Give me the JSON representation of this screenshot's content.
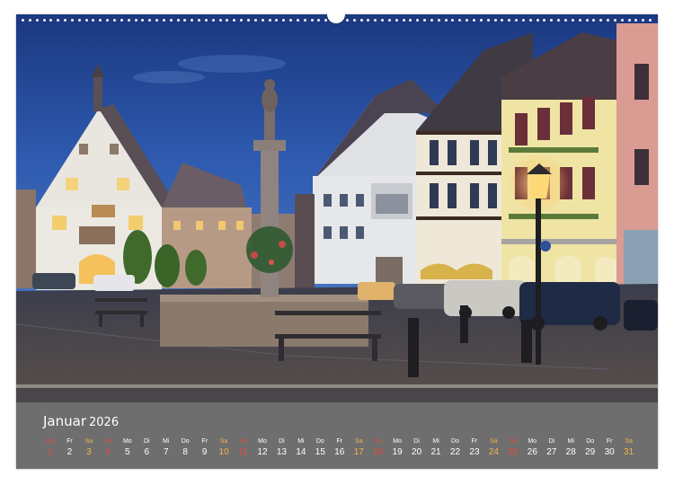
{
  "calendar": {
    "month": "Januar",
    "year": "2026",
    "colors": {
      "background": "#6e6e6e",
      "weekday": "#ffffff",
      "saturday": "#f5b14a",
      "sunday": "#e34b3c"
    },
    "days": [
      {
        "wd": "Do",
        "d": "1",
        "type": "holiday"
      },
      {
        "wd": "Fr",
        "d": "2",
        "type": "weekday"
      },
      {
        "wd": "Sa",
        "d": "3",
        "type": "sat"
      },
      {
        "wd": "So",
        "d": "4",
        "type": "sun"
      },
      {
        "wd": "Mo",
        "d": "5",
        "type": "weekday"
      },
      {
        "wd": "Di",
        "d": "6",
        "type": "weekday"
      },
      {
        "wd": "Mi",
        "d": "7",
        "type": "weekday"
      },
      {
        "wd": "Do",
        "d": "8",
        "type": "weekday"
      },
      {
        "wd": "Fr",
        "d": "9",
        "type": "weekday"
      },
      {
        "wd": "Sa",
        "d": "10",
        "type": "sat"
      },
      {
        "wd": "So",
        "d": "11",
        "type": "sun"
      },
      {
        "wd": "Mo",
        "d": "12",
        "type": "weekday"
      },
      {
        "wd": "Di",
        "d": "13",
        "type": "weekday"
      },
      {
        "wd": "Mi",
        "d": "14",
        "type": "weekday"
      },
      {
        "wd": "Do",
        "d": "15",
        "type": "weekday"
      },
      {
        "wd": "Fr",
        "d": "16",
        "type": "weekday"
      },
      {
        "wd": "Sa",
        "d": "17",
        "type": "sat"
      },
      {
        "wd": "So",
        "d": "18",
        "type": "sun"
      },
      {
        "wd": "Mo",
        "d": "19",
        "type": "weekday"
      },
      {
        "wd": "Di",
        "d": "20",
        "type": "weekday"
      },
      {
        "wd": "Mi",
        "d": "21",
        "type": "weekday"
      },
      {
        "wd": "Do",
        "d": "22",
        "type": "weekday"
      },
      {
        "wd": "Fr",
        "d": "23",
        "type": "weekday"
      },
      {
        "wd": "Sa",
        "d": "24",
        "type": "sat"
      },
      {
        "wd": "So",
        "d": "25",
        "type": "sun"
      },
      {
        "wd": "Mo",
        "d": "26",
        "type": "weekday"
      },
      {
        "wd": "Di",
        "d": "27",
        "type": "weekday"
      },
      {
        "wd": "Mi",
        "d": "28",
        "type": "weekday"
      },
      {
        "wd": "Do",
        "d": "29",
        "type": "weekday"
      },
      {
        "wd": "Fr",
        "d": "30",
        "type": "weekday"
      },
      {
        "wd": "Sa",
        "d": "31",
        "type": "sat"
      }
    ]
  },
  "photo": {
    "subject": "town-square-fountain-night",
    "sky_colors": [
      "#1d3f8c",
      "#2f5fb5",
      "#4b78c4"
    ]
  }
}
